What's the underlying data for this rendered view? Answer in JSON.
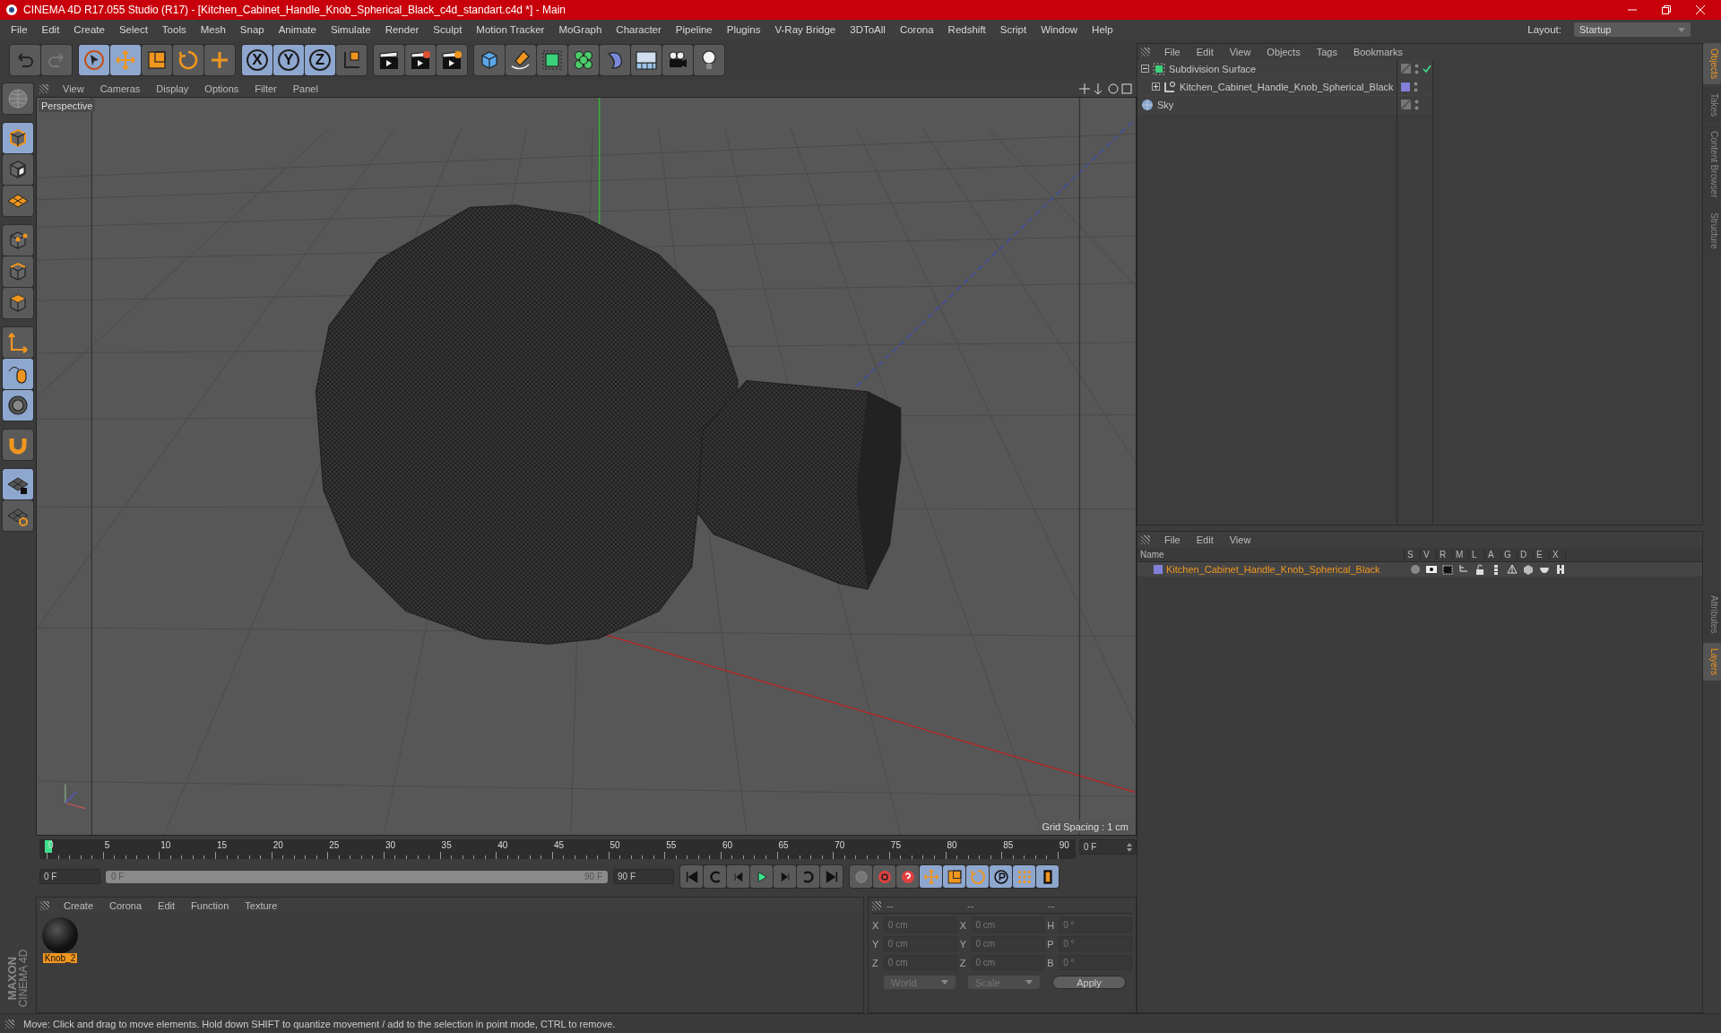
{
  "window": {
    "title": "CINEMA 4D R17.055 Studio (R17) - [Kitchen_Cabinet_Handle_Knob_Spherical_Black_c4d_standart.c4d *] - Main"
  },
  "menu": [
    "File",
    "Edit",
    "Create",
    "Select",
    "Tools",
    "Mesh",
    "Snap",
    "Animate",
    "Simulate",
    "Render",
    "Sculpt",
    "Motion Tracker",
    "MoGraph",
    "Character",
    "Pipeline",
    "Plugins",
    "V-Ray Bridge",
    "3DToAll",
    "Corona",
    "Redshift",
    "Script",
    "Window",
    "Help"
  ],
  "layout": {
    "label": "Layout:",
    "value": "Startup"
  },
  "toolbar": [
    {
      "kind": "undo",
      "selected": false
    },
    {
      "kind": "redo",
      "selected": false
    },
    {
      "kind": "select",
      "selected": true
    },
    {
      "kind": "move",
      "selected": true
    },
    {
      "kind": "scale",
      "selected": false
    },
    {
      "kind": "rotate",
      "selected": false
    },
    {
      "kind": "add",
      "selected": false
    },
    {
      "kind": "axis",
      "label": "X",
      "selected": true
    },
    {
      "kind": "axis",
      "label": "Y",
      "selected": true
    },
    {
      "kind": "axis",
      "label": "Z",
      "selected": true
    },
    {
      "kind": "coord",
      "selected": false
    },
    {
      "kind": "clapper",
      "selected": false
    },
    {
      "kind": "clapper-play",
      "selected": false
    },
    {
      "kind": "clapper-gear",
      "selected": false
    },
    {
      "kind": "cube",
      "selected": false
    },
    {
      "kind": "pen",
      "selected": false
    },
    {
      "kind": "subdiv",
      "selected": false
    },
    {
      "kind": "cloner",
      "selected": false
    },
    {
      "kind": "deformer",
      "selected": false
    },
    {
      "kind": "floor",
      "selected": false
    },
    {
      "kind": "camera",
      "selected": false
    },
    {
      "kind": "bulb",
      "selected": false
    }
  ],
  "left_tools": [
    {
      "kind": "globe",
      "selected": false
    },
    {
      "kind": "cube-model",
      "selected": true
    },
    {
      "kind": "cube-texture",
      "selected": false
    },
    {
      "kind": "grid-plane",
      "selected": false
    },
    {
      "kind": "cube-points",
      "selected": false
    },
    {
      "kind": "cube-edges",
      "selected": false
    },
    {
      "kind": "cube-polygon",
      "selected": false
    },
    {
      "kind": "axis-corner",
      "selected": false
    },
    {
      "kind": "mouse",
      "selected": true
    },
    {
      "kind": "snap",
      "selected": true
    },
    {
      "kind": "magnet",
      "selected": false
    },
    {
      "kind": "grid-lock",
      "selected": true
    },
    {
      "kind": "grid-rotate",
      "selected": false
    }
  ],
  "viewport": {
    "menu": [
      "View",
      "Cameras",
      "Display",
      "Options",
      "Filter",
      "Panel"
    ],
    "camera": "Perspective",
    "grid_spacing": "Grid Spacing : 1 cm"
  },
  "timeline": {
    "ticks": [
      "0",
      "5",
      "10",
      "15",
      "20",
      "25",
      "30",
      "35",
      "40",
      "45",
      "50",
      "55",
      "60",
      "65",
      "70",
      "75",
      "80",
      "85",
      "90"
    ],
    "current_frame": "0 F",
    "start": "0 F",
    "range_start": "0 F",
    "range_end": "90 F",
    "range": {
      "level": 1
    },
    "end": "90 F",
    "keys": [
      {
        "kind": "key-off",
        "selected": false
      },
      {
        "kind": "record",
        "selected": false
      },
      {
        "kind": "question",
        "selected": false
      },
      {
        "kind": "move",
        "selected": true
      },
      {
        "kind": "scale",
        "selected": true
      },
      {
        "kind": "rotate",
        "selected": true
      },
      {
        "kind": "param",
        "selected": true
      },
      {
        "kind": "dots",
        "selected": true
      },
      {
        "kind": "film",
        "selected": true
      }
    ]
  },
  "materials": {
    "menu": [
      "Create",
      "Corona",
      "Edit",
      "Function",
      "Texture"
    ],
    "items": [
      {
        "name": "Knob_2",
        "selected": true
      }
    ]
  },
  "coordinates": {
    "headers": [
      "--",
      "--",
      "--"
    ],
    "rows": [
      {
        "label": "X",
        "value": "0 cm",
        "label_2": "X",
        "value_2": "0 cm",
        "label_3": "H",
        "value_3": "0 °"
      },
      {
        "label": "Y",
        "value": "0 cm",
        "label_2": "Y",
        "value_2": "0 cm",
        "label_3": "P",
        "value_3": "0 °"
      },
      {
        "label": "Z",
        "value": "0 cm",
        "label_2": "Z",
        "value_2": "0 cm",
        "label_3": "B",
        "value_3": "0 °"
      }
    ],
    "mode": "World",
    "type": "Scale",
    "apply": "Apply"
  },
  "objects": {
    "menu": [
      "File",
      "Edit",
      "View",
      "Objects",
      "Tags",
      "Bookmarks"
    ],
    "tree": [
      {
        "name": "Subdivision Surface",
        "kind": "subdivision",
        "expanded": true,
        "enabled": true,
        "children": [
          {
            "name": "Kitchen_Cabinet_Handle_Knob_Spherical_Black",
            "kind": "null",
            "expanded": false,
            "color": "#8080d8"
          }
        ]
      },
      {
        "name": "Sky",
        "kind": "sky"
      }
    ]
  },
  "layers": {
    "menu": [
      "File",
      "Edit",
      "View"
    ],
    "columns": [
      "Name",
      "S",
      "V",
      "R",
      "M",
      "L",
      "A",
      "G",
      "D",
      "E",
      "X"
    ],
    "rows": [
      {
        "name": "Kitchen_Cabinet_Handle_Knob_Spherical_Black",
        "color": "#8080d8"
      }
    ]
  },
  "side_tabs_top": [
    {
      "label": "Objects",
      "selected": true
    },
    {
      "label": "Takes",
      "selected": false
    },
    {
      "label": "Content Browser",
      "selected": false
    },
    {
      "label": "Structure",
      "selected": false
    }
  ],
  "side_tabs_bottom": [
    {
      "label": "Attributes",
      "selected": false
    },
    {
      "label": "Layers",
      "selected": true
    }
  ],
  "logo": {
    "brand": "MAXON",
    "product": "CINEMA 4D"
  },
  "status": "Move: Click and drag to move elements. Hold down SHIFT to quantize movement / add to the selection in point mode, CTRL to remove."
}
